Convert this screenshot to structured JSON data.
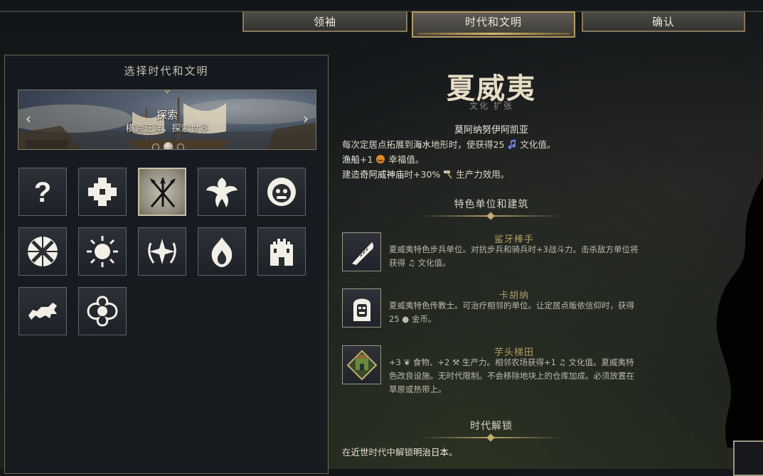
{
  "tabs": [
    {
      "label": "领袖",
      "active": false
    },
    {
      "label": "时代和文明",
      "active": true
    },
    {
      "label": "确认",
      "active": false
    }
  ],
  "left_panel": {
    "title": "选择时代和文明",
    "banner": {
      "title": "探索",
      "subtitle": "横跨汪洋，探索世界",
      "prev_icon": "chevron-left-icon",
      "next_icon": "chevron-right-icon",
      "page_count": 3,
      "current_page": 2
    },
    "civ_icons": [
      {
        "name": "random-question-icon",
        "selected": false
      },
      {
        "name": "cross-emblem-icon",
        "selected": false
      },
      {
        "name": "crossed-spears-icon",
        "selected": true
      },
      {
        "name": "phoenix-icon",
        "selected": false
      },
      {
        "name": "lion-mask-icon",
        "selected": false
      },
      {
        "name": "woven-circle-icon",
        "selected": false
      },
      {
        "name": "sun-icon",
        "selected": false
      },
      {
        "name": "laurel-star-icon",
        "selected": false
      },
      {
        "name": "flame-icon",
        "selected": false
      },
      {
        "name": "castle-icon",
        "selected": false
      },
      {
        "name": "heraldic-lion-icon",
        "selected": false
      },
      {
        "name": "ornate-quatrefoil-icon",
        "selected": false
      }
    ]
  },
  "civ": {
    "name": "夏威夷",
    "tags": "文化 扩张",
    "ability_name": "莫阿纳努伊阿凯亚",
    "ability_lines": [
      {
        "parts": [
          "每次定居点拓展到",
          "海水",
          "地形时，使获得25 ",
          "",
          " 文化值。"
        ]
      },
      {
        "parts": [
          "渔船",
          "",
          "+1 ",
          "",
          " 幸福值。"
        ]
      },
      {
        "parts": [
          "建造",
          "奇阿威神庙",
          "时+30% ",
          "",
          " 生产力效用。"
        ]
      }
    ]
  },
  "unique_section": {
    "heading": "特色单位和建筑",
    "items": [
      {
        "name": "鲨牙棒手",
        "icon": "shark-club-icon",
        "desc": "夏威夷特色步兵单位。对抗步兵和骑兵时+3战斗力。击杀敌方单位将获得 ♫ 文化值。"
      },
      {
        "name": "卡胡纳",
        "icon": "kahuna-mask-icon",
        "desc": "夏威夷特色传教士。可治疗相邻的单位。让定居点皈依信仰时，获得25 ● 金币。"
      },
      {
        "name": "芋头梯田",
        "icon": "taro-terrace-icon",
        "desc": "+3 ❦ 食物、+2 ⚒ 生产力。相邻农场获得+1 ♫ 文化值。夏威夷特色改良设施。无时代限制。不会移除地块上的仓库加成。必须放置在草原或热带上。"
      }
    ]
  },
  "unlock_section": {
    "heading": "时代解锁",
    "text_prefix": "在",
    "era": "近世",
    "text_mid": "时代中解锁",
    "target": "明治日本",
    "text_suffix": "。"
  },
  "colors": {
    "gold_accent": "#c7ad72",
    "culture": "#6f7fe0",
    "happiness": "#e08a2a",
    "production": "#b08a5a",
    "gold": "#e0b434",
    "food": "#8ab83a"
  }
}
